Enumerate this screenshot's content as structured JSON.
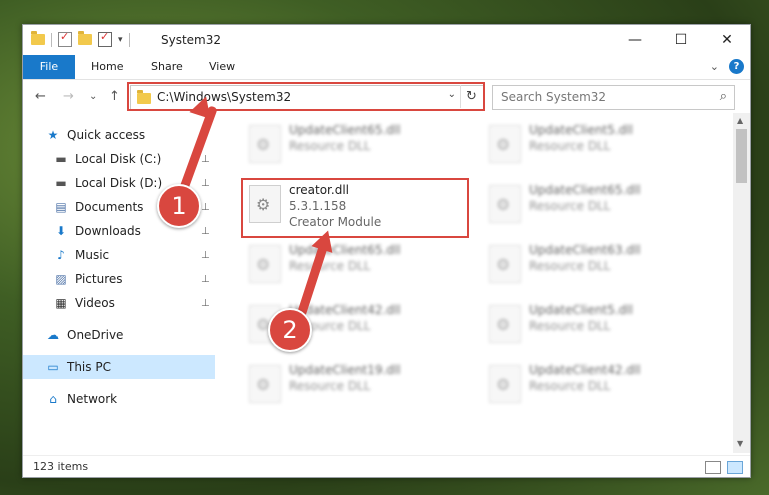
{
  "window": {
    "title": "System32",
    "min_icon": "—",
    "max_icon": "☐",
    "close_icon": "✕"
  },
  "ribbon": {
    "file": "File",
    "home": "Home",
    "share": "Share",
    "view": "View",
    "collapse_icon": "⌄",
    "help": "?"
  },
  "nav_buttons": {
    "back": "←",
    "forward": "→",
    "recent": "⌄",
    "up": "↑"
  },
  "address": {
    "path": "C:\\Windows\\System32",
    "dropdown": "⌄",
    "refresh": "↻"
  },
  "search": {
    "placeholder": "Search System32",
    "icon": "⌕"
  },
  "sidebar": {
    "items": [
      {
        "label": "Quick access",
        "icon": "★"
      },
      {
        "label": "Local Disk (C:)",
        "icon": "▬"
      },
      {
        "label": "Local Disk (D:)",
        "icon": "▬"
      },
      {
        "label": "Documents",
        "icon": "▤"
      },
      {
        "label": "Downloads",
        "icon": "⬇"
      },
      {
        "label": "Music",
        "icon": "♪"
      },
      {
        "label": "Pictures",
        "icon": "▨"
      },
      {
        "label": "Videos",
        "icon": "▦"
      },
      {
        "label": "OneDrive",
        "icon": "☁"
      },
      {
        "label": "This PC",
        "icon": "▭"
      },
      {
        "label": "Network",
        "icon": "⌂"
      }
    ],
    "pin": "📌"
  },
  "files": {
    "c1r1": {
      "name": "UpdateClient65.dll",
      "desc": "Resource DLL"
    },
    "c2r1": {
      "name": "UpdateClient5.dll",
      "desc": "Resource DLL"
    },
    "highlight": {
      "name": "creator.dll",
      "version": "5.3.1.158",
      "desc": "Creator Module"
    },
    "c2r2": {
      "name": "UpdateClient65.dll",
      "desc": "Resource DLL"
    },
    "c1r3": {
      "name": "UpdateClient65.dll",
      "desc": "Resource DLL"
    },
    "c2r3": {
      "name": "UpdateClient63.dll",
      "desc": "Resource DLL"
    },
    "c1r4": {
      "name": "UpdateClient42.dll",
      "desc": "Resource DLL"
    },
    "c2r4": {
      "name": "UpdateClient5.dll",
      "desc": "Resource DLL"
    },
    "c1r5": {
      "name": "UpdateClient19.dll",
      "desc": "Resource DLL"
    },
    "c2r5": {
      "name": "UpdateClient42.dll",
      "desc": "Resource DLL"
    }
  },
  "status": {
    "count": "123 items"
  },
  "annotations": {
    "step1": "1",
    "step2": "2",
    "color": "#d9473f"
  }
}
